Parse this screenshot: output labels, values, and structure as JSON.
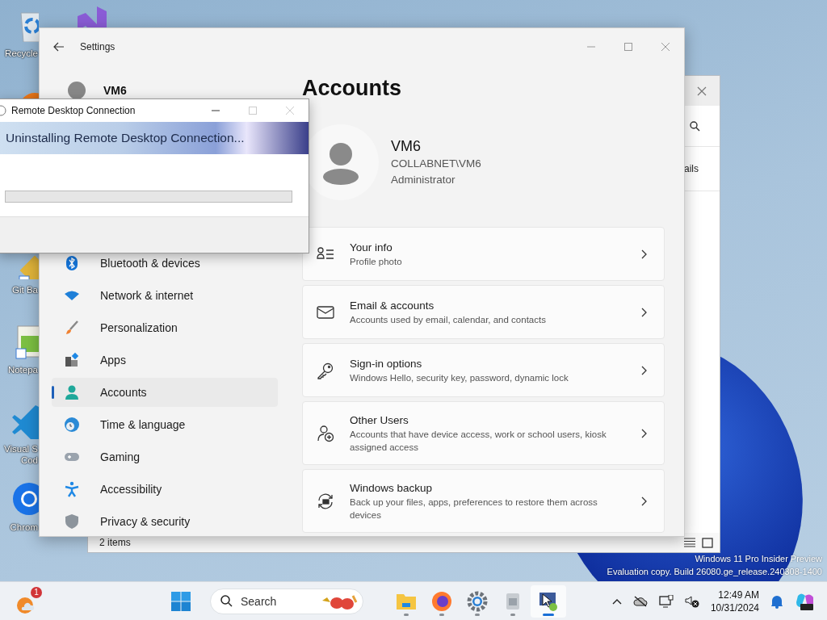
{
  "desktop_icons": [
    {
      "kind": "recycle-bin",
      "lines": [
        "Recycle"
      ]
    },
    {
      "kind": "purple-logo"
    },
    {
      "kind": "orange-ring"
    },
    {
      "kind": "git",
      "lines": [
        "Git Ba"
      ]
    },
    {
      "kind": "notepad",
      "lines": [
        "Notepa"
      ]
    },
    {
      "kind": "code",
      "lines": [
        "Visual S",
        "Cod"
      ]
    },
    {
      "kind": "chrome",
      "lines": [
        "Chrom"
      ]
    }
  ],
  "background_window": {
    "toolbar_text": "ails",
    "status": "2 items"
  },
  "settings": {
    "title": "Settings",
    "user_name": "VM6",
    "nav": [
      {
        "kind": "bluetooth",
        "label": "Bluetooth & devices",
        "selected": false
      },
      {
        "kind": "network",
        "label": "Network & internet",
        "selected": false
      },
      {
        "kind": "brush",
        "label": "Personalization",
        "selected": false
      },
      {
        "kind": "apps",
        "label": "Apps",
        "selected": false
      },
      {
        "kind": "accounts",
        "label": "Accounts",
        "selected": true
      },
      {
        "kind": "time",
        "label": "Time & language",
        "selected": false
      },
      {
        "kind": "gaming",
        "label": "Gaming",
        "selected": false
      },
      {
        "kind": "accessibility",
        "label": "Accessibility",
        "selected": false
      },
      {
        "kind": "privacy",
        "label": "Privacy & security",
        "selected": false
      }
    ],
    "heading": "Accounts",
    "profile": {
      "name": "VM6",
      "account": "COLLABNET\\VM6",
      "role": "Administrator"
    },
    "cards": [
      {
        "kind": "info",
        "title": "Your info",
        "subtitle": "Profile photo"
      },
      {
        "kind": "email",
        "title": "Email & accounts",
        "subtitle": "Accounts used by email, calendar, and contacts"
      },
      {
        "kind": "key",
        "title": "Sign-in options",
        "subtitle": "Windows Hello, security key, password, dynamic lock"
      },
      {
        "kind": "users",
        "title": "Other Users",
        "subtitle": "Accounts that have device access, work or school users, kiosk assigned access"
      },
      {
        "kind": "backup",
        "title": "Windows backup",
        "subtitle": "Back up your files, apps, preferences to restore them across devices"
      }
    ]
  },
  "dialog": {
    "title": "Remote Desktop Connection",
    "message": "Uninstalling Remote Desktop Connection...",
    "progress": {
      "level": 0
    }
  },
  "watermark": [
    "Windows 11 Pro Insider Preview",
    "Evaluation copy. Build 26080.ge_release.240308-1400"
  ],
  "taskbar": {
    "widget_badge": "1",
    "search": {
      "placeholder": "Search"
    },
    "apps": [
      {
        "kind": "folder",
        "running": true,
        "selected": false
      },
      {
        "kind": "firefox",
        "running": true,
        "selected": false
      },
      {
        "kind": "gear",
        "running": true,
        "selected": false
      },
      {
        "kind": "installer",
        "running": true,
        "selected": false
      },
      {
        "kind": "remote",
        "running": true,
        "selected": true
      }
    ],
    "time": "12:49 AM",
    "date": "10/31/2024"
  }
}
